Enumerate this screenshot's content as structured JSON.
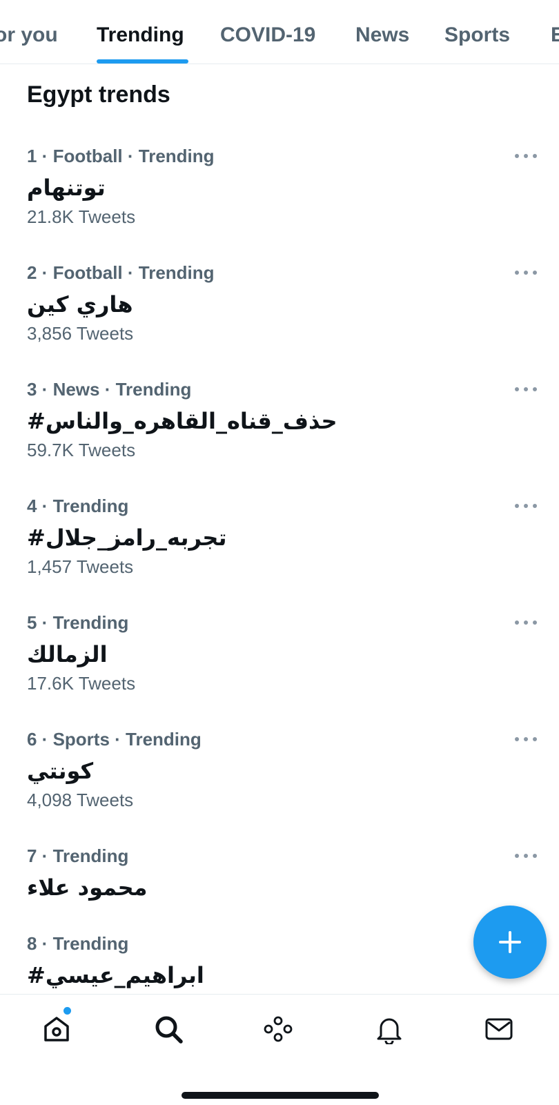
{
  "tabs": [
    {
      "label": "or you"
    },
    {
      "label": "Trending"
    },
    {
      "label": "COVID-19"
    },
    {
      "label": "News"
    },
    {
      "label": "Sports"
    },
    {
      "label": "E"
    }
  ],
  "active_tab": "Trending",
  "section_title": "Egypt trends",
  "trends": [
    {
      "meta": "1 · Football · Trending",
      "name": "توتنهام",
      "count": "21.8K Tweets"
    },
    {
      "meta": "2 · Football · Trending",
      "name": "هاري كين",
      "count": "3,856 Tweets"
    },
    {
      "meta": "3 · News · Trending",
      "name": "#حذف_قناه_القاهره_والناس",
      "count": "59.7K Tweets"
    },
    {
      "meta": "4 · Trending",
      "name": "#تجربه_رامز_جلال",
      "count": "1,457 Tweets"
    },
    {
      "meta": "5 · Trending",
      "name": "الزمالك",
      "count": "17.6K Tweets"
    },
    {
      "meta": "6 · Sports · Trending",
      "name": "كونتي",
      "count": "4,098 Tweets"
    },
    {
      "meta": "7 · Trending",
      "name": "محمود علاء",
      "count": ""
    },
    {
      "meta": "8 · Trending",
      "name": "#ابراهيم_عيسي",
      "count": ""
    }
  ],
  "icons": {
    "compose": "plus-icon",
    "nav": [
      "home-icon",
      "search-icon",
      "spaces-icon",
      "notifications-icon",
      "messages-icon"
    ],
    "more": "more-dots-icon"
  },
  "colors": {
    "accent": "#1d9bf0",
    "text_primary": "#0f1419",
    "text_secondary": "#536471"
  }
}
